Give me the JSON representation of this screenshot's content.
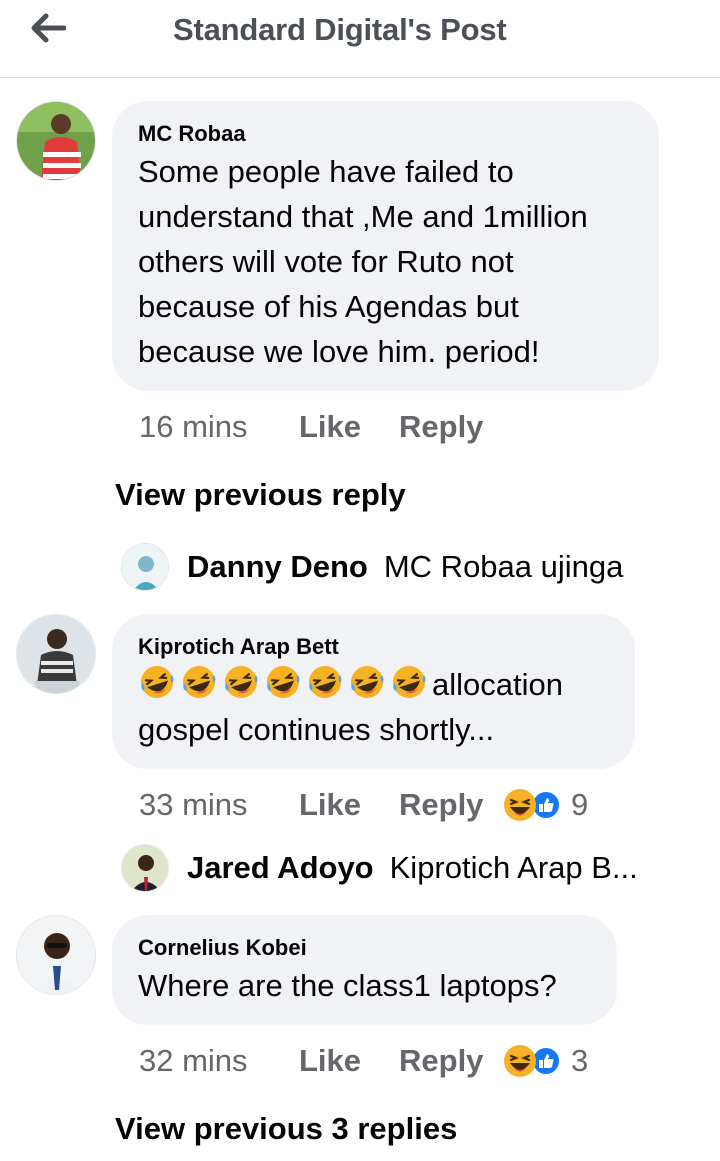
{
  "header": {
    "title": "Standard Digital's Post"
  },
  "comments": [
    {
      "author": "MC Robaa",
      "lines": [
        "Some people have failed to",
        "understand that ,Me and 1million",
        "others will vote for Ruto not",
        "because of his Agendas but",
        "because we love him. period!"
      ],
      "time": "16 mins",
      "like_label": "Like",
      "reply_label": "Reply"
    },
    {
      "author": "Kiprotich Arap Bett",
      "emoji_count": 7,
      "line1_text": "allocation",
      "line2": "gospel continues shortly...",
      "time": "33 mins",
      "like_label": "Like",
      "reply_label": "Reply",
      "reaction_count": "9"
    },
    {
      "author": "Cornelius Kobei",
      "lines": [
        "Where are the class1 laptops?"
      ],
      "time": "32 mins",
      "like_label": "Like",
      "reply_label": "Reply",
      "reaction_count": "3"
    }
  ],
  "view_previous": [
    "View previous reply",
    "View previous 3 replies"
  ],
  "replies": [
    {
      "author": "Danny Deno",
      "text": "MC Robaa ujinga"
    },
    {
      "author": "Jared Adoyo",
      "text": "Kiprotich Arap B..."
    }
  ],
  "icons": {
    "back": "arrow-left-icon",
    "haha": "haha-reaction-icon",
    "like": "like-reaction-icon",
    "laugh": "rolling-laughing-emoji"
  },
  "colors": {
    "bubble": "#f0f2f5",
    "secondary_text": "#65676b",
    "like_blue": "#1877f2",
    "emoji_yellow": "#f7b125"
  }
}
